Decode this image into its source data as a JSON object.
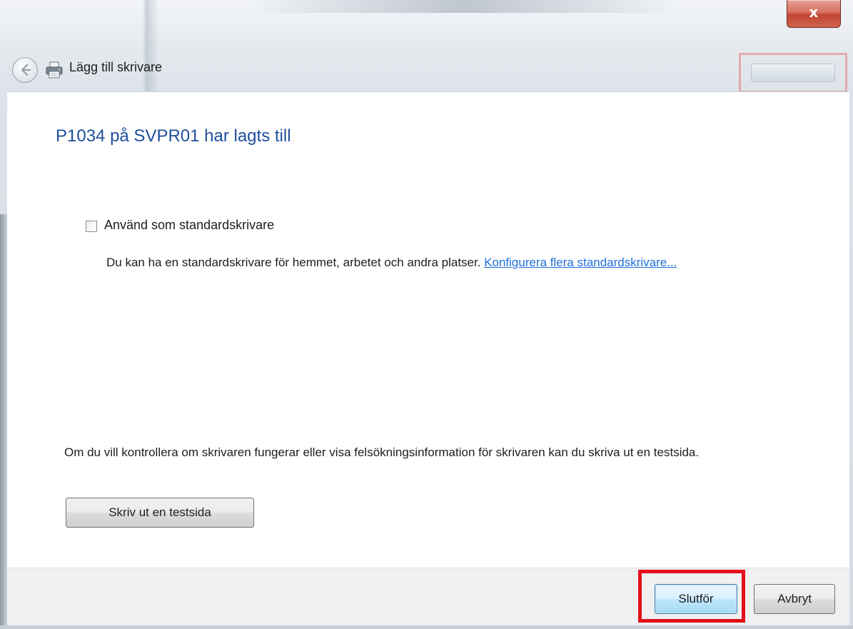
{
  "window": {
    "title": "Lägg till skrivare",
    "close_label": "x"
  },
  "main": {
    "heading": "P1034 på SVPR01 har lagts till",
    "default_printer": {
      "label": "Använd som standardskrivare",
      "checked": false,
      "description": "Du kan ha en standardskrivare för hemmet, arbetet och andra platser.",
      "link": "Konfigurera flera standardskrivare..."
    },
    "test_info": "Om du vill kontrollera om skrivaren fungerar eller visa felsökningsinformation för skrivaren kan du skriva ut en testsida.",
    "test_button": "Skriv ut en testsida"
  },
  "footer": {
    "finish_label": "Slutför",
    "cancel_label": "Avbryt"
  },
  "colors": {
    "heading": "#1e4e9b",
    "link": "#1f6fd8",
    "highlight": "#e3101a",
    "close_button": "#c04431"
  },
  "icons": {
    "back": "back-arrow-icon",
    "printer": "printer-icon",
    "close": "close-icon"
  }
}
